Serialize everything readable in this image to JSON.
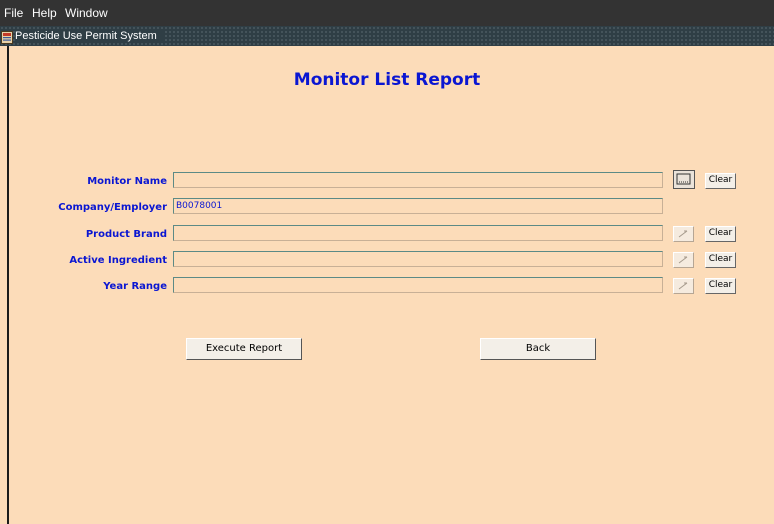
{
  "menubar": {
    "items": [
      {
        "label": "File"
      },
      {
        "label": "Help"
      },
      {
        "label": "Window"
      }
    ]
  },
  "window": {
    "title": "Pesticide Use Permit System"
  },
  "page": {
    "title": "Monitor List Report"
  },
  "form": {
    "fields": [
      {
        "label": "Monitor Name",
        "value": "",
        "has_lov": true,
        "lov_active": true,
        "clear_label": "Clear"
      },
      {
        "label": "Company/Employer",
        "value": "B0078001",
        "has_lov": false
      },
      {
        "label": "Product Brand",
        "value": "",
        "has_lov": true,
        "lov_active": false,
        "clear_label": "Clear"
      },
      {
        "label": "Active Ingredient",
        "value": "",
        "has_lov": true,
        "lov_active": false,
        "clear_label": "Clear"
      },
      {
        "label": "Year Range",
        "value": "",
        "has_lov": true,
        "lov_active": false,
        "clear_label": "Clear"
      }
    ]
  },
  "actions": {
    "execute_label": "Execute Report",
    "back_label": "Back"
  },
  "colors": {
    "panel_background": "#fcdcb9",
    "label_text": "#0a16d2",
    "menubar_background": "#333333"
  }
}
